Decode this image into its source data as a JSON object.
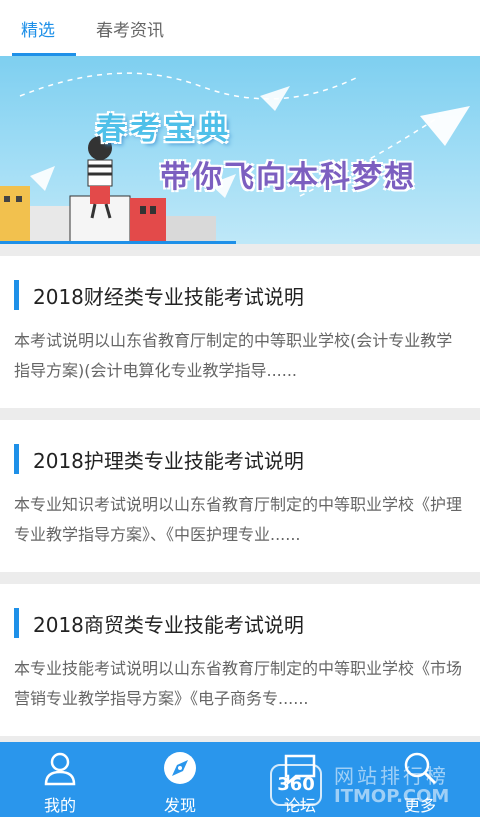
{
  "tabs": [
    {
      "label": "精选",
      "active": true
    },
    {
      "label": "春考资讯",
      "active": false
    }
  ],
  "banner": {
    "title": "春考宝典",
    "subtitle": "带你飞向本科梦想"
  },
  "articles": [
    {
      "title": "2018财经类专业技能考试说明",
      "summary": "本考试说明以山东省教育厅制定的中等职业学校(会计专业教学指导方案)(会计电算化专业教学指导......"
    },
    {
      "title": "2018护理类专业技能考试说明",
      "summary": "本专业知识考试说明以山东省教育厅制定的中等职业学校《护理专业教学指导方案》、《中医护理专业......"
    },
    {
      "title": "2018商贸类专业技能考试说明",
      "summary": "本专业技能考试说明以山东省教育厅制定的中等职业学校《市场营销专业教学指导方案》《电子商务专......"
    }
  ],
  "nav": [
    {
      "label": "我的",
      "icon": "user-icon"
    },
    {
      "label": "发现",
      "icon": "compass-icon"
    },
    {
      "label": "论坛",
      "icon": "chat-icon"
    },
    {
      "label": "更多",
      "icon": "search-icon"
    }
  ],
  "watermark": {
    "badge": "360",
    "text": "网站排行榜",
    "sub": "ITMOP.COM"
  },
  "colors": {
    "accent": "#1e90e8",
    "nav_bg": "#2a96ec"
  }
}
